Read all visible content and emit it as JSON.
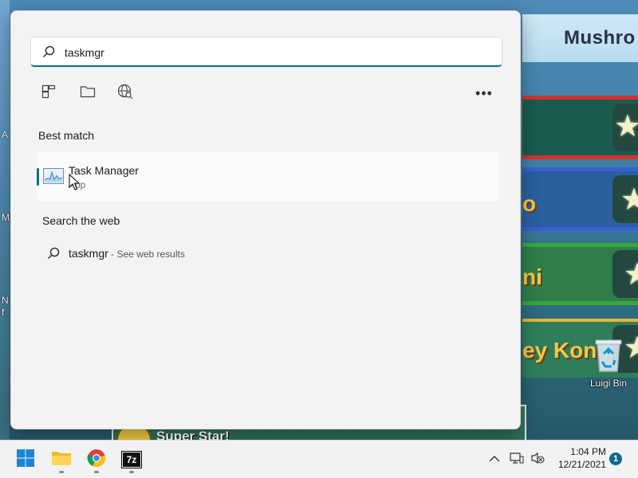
{
  "search": {
    "query": "taskmgr",
    "icon": "search-icon"
  },
  "filters": [
    {
      "name": "apps-filter",
      "icon": "apps-icon"
    },
    {
      "name": "documents-filter",
      "icon": "folder-icon"
    },
    {
      "name": "web-filter",
      "icon": "globe-icon"
    }
  ],
  "more_label": "•••",
  "best_match": {
    "heading": "Best match",
    "app_name": "Task Manager",
    "app_type": "App",
    "icon": "task-manager-icon"
  },
  "web": {
    "heading": "Search the web",
    "query": "taskmgr",
    "suffix": " - See web results"
  },
  "desktop": {
    "wallpaper_title": "Mushro",
    "wallpaper_words": [
      "o",
      "ni",
      "ey Kon"
    ],
    "bottom_banner": "Super Star!",
    "recycle_bin_label": "Luigi Bin",
    "left_fragments": [
      "A",
      "M",
      "N",
      "f"
    ]
  },
  "taskbar": {
    "apps": [
      "start-button",
      "file-explorer",
      "chrome",
      "7-zip"
    ],
    "sevenzip_label": "7z",
    "time": "1:04 PM",
    "date": "12/21/2021",
    "notification_count": "1"
  },
  "colors": {
    "accent": "#0a6b8c",
    "panel_bg": "#f3f3f3",
    "taskbar_bg": "#f0f2f4"
  }
}
